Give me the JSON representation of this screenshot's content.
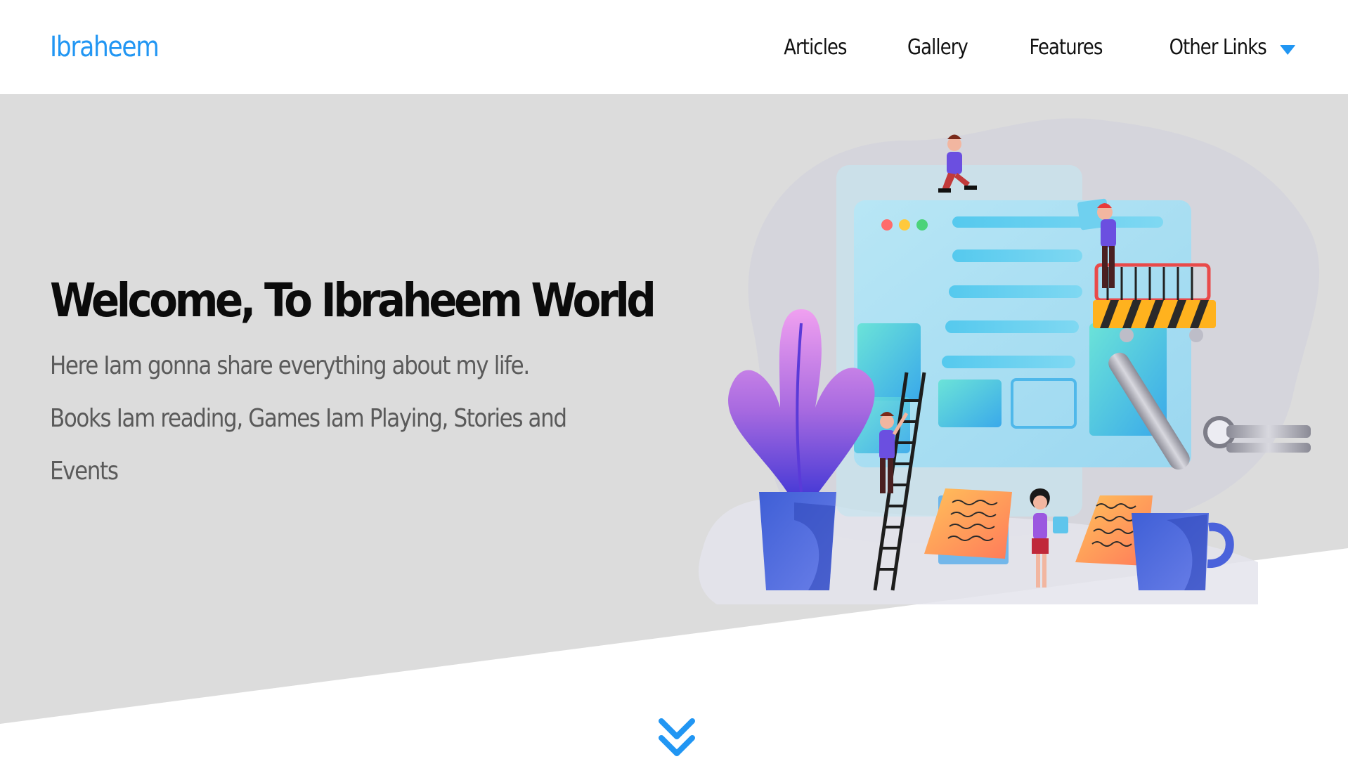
{
  "header": {
    "logo": "Ibraheem",
    "nav": [
      {
        "label": "Articles"
      },
      {
        "label": "Gallery"
      },
      {
        "label": "Features"
      },
      {
        "label": "Other Links",
        "icon": "caret-down-icon"
      }
    ]
  },
  "hero": {
    "title": "Welcome, To Ibraheem World",
    "description": "Here Iam gonna share everything about my life. Books Iam reading, Games Iam Playing, Stories and Events"
  },
  "scroll": {
    "icon": "double-chevron-down-icon"
  },
  "colors": {
    "accent": "#2196f3",
    "hero_background": "#dcdcdc",
    "title": "#0b0b0b",
    "description": "#5a5a5a"
  }
}
